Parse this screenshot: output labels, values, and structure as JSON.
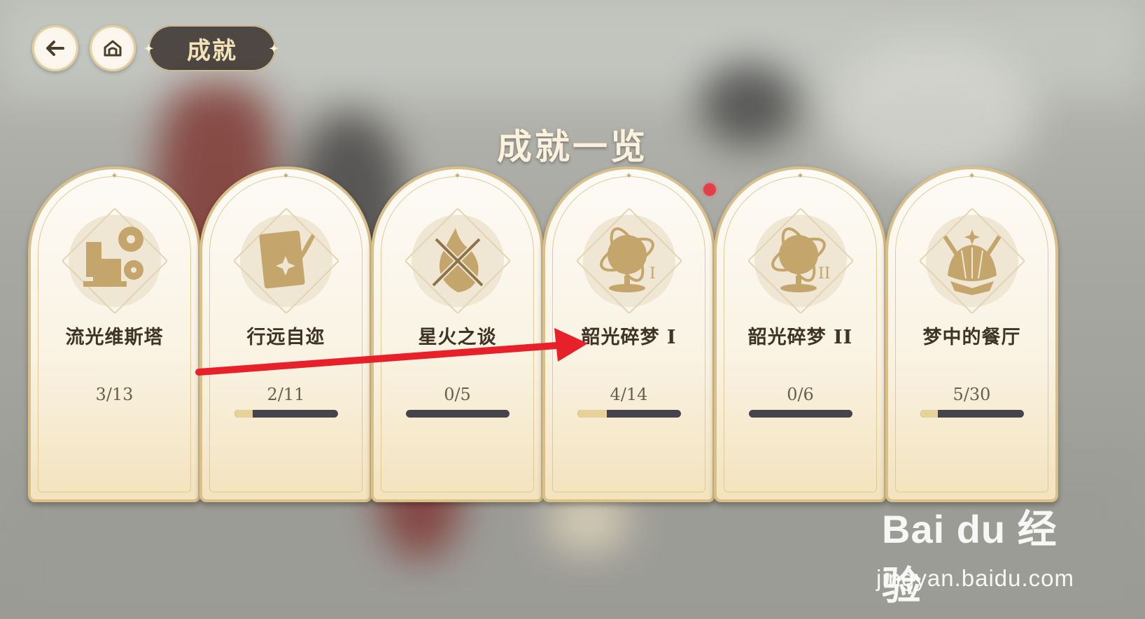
{
  "header": {
    "back_icon": "arrow-left-icon",
    "home_icon": "home-icon",
    "title": "成就"
  },
  "heading": "成就一览",
  "cards": [
    {
      "name": "流光维斯塔",
      "count": "3/13",
      "progress": 0.23,
      "icon": "film-camera-icon",
      "show_bar": false
    },
    {
      "name": "行远自迩",
      "count": "2/11",
      "progress": 0.18,
      "icon": "notebook-quill-icon",
      "show_bar": true
    },
    {
      "name": "星火之谈",
      "count": "0/5",
      "progress": 0.0,
      "icon": "knives-flame-icon",
      "show_bar": true
    },
    {
      "name": "韶光碎梦 I",
      "count": "4/14",
      "progress": 0.29,
      "icon": "armillary-sphere-i-icon",
      "show_bar": true
    },
    {
      "name": "韶光碎梦 II",
      "count": "0/6",
      "progress": 0.0,
      "icon": "armillary-sphere-ii-icon",
      "show_bar": true
    },
    {
      "name": "梦中的餐厅",
      "count": "5/30",
      "progress": 0.17,
      "icon": "shell-cutlery-icon",
      "show_bar": true
    }
  ],
  "watermark": {
    "logo": "Bai du 经验",
    "url": "jingyan.baidu.com"
  },
  "colors": {
    "accent_gold": "#d9c08a",
    "progress_fill": "#e8d29c",
    "progress_track": "#45444c",
    "notification_dot": "#e24048",
    "annotation_arrow": "#e8202a"
  }
}
